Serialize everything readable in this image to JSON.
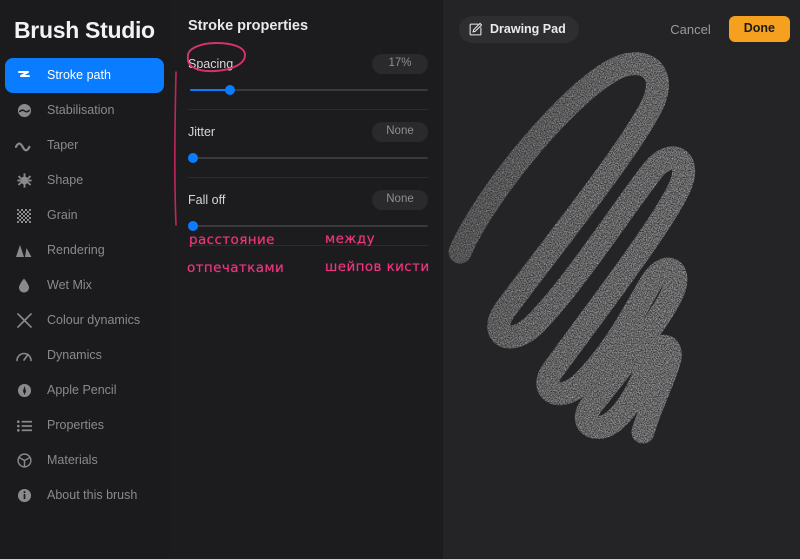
{
  "app": {
    "title": "Brush Studio"
  },
  "sidebar": {
    "items": [
      {
        "label": "Stroke path",
        "icon": "stroke-path-icon",
        "active": true
      },
      {
        "label": "Stabilisation",
        "icon": "stabilisation-icon",
        "active": false
      },
      {
        "label": "Taper",
        "icon": "taper-icon",
        "active": false
      },
      {
        "label": "Shape",
        "icon": "shape-icon",
        "active": false
      },
      {
        "label": "Grain",
        "icon": "grain-icon",
        "active": false
      },
      {
        "label": "Rendering",
        "icon": "rendering-icon",
        "active": false
      },
      {
        "label": "Wet Mix",
        "icon": "wet-mix-icon",
        "active": false
      },
      {
        "label": "Colour dynamics",
        "icon": "colour-dynamics-icon",
        "active": false
      },
      {
        "label": "Dynamics",
        "icon": "dynamics-icon",
        "active": false
      },
      {
        "label": "Apple Pencil",
        "icon": "apple-pencil-icon",
        "active": false
      },
      {
        "label": "Properties",
        "icon": "properties-icon",
        "active": false
      },
      {
        "label": "Materials",
        "icon": "materials-icon",
        "active": false
      },
      {
        "label": "About this brush",
        "icon": "about-brush-icon",
        "active": false
      }
    ]
  },
  "properties": {
    "section_title": "Stroke properties",
    "sliders": [
      {
        "label": "Spacing",
        "value": "17%",
        "percent": 17
      },
      {
        "label": "Jitter",
        "value": "None",
        "percent": 0
      },
      {
        "label": "Fall off",
        "value": "None",
        "percent": 0
      }
    ]
  },
  "annotations": {
    "line1": "расстояние",
    "line2": "между",
    "line3": "отпечатками",
    "line4": "шейпов кисти"
  },
  "canvas": {
    "pad_label": "Drawing Pad",
    "pad_icon": "compose-icon",
    "cancel_label": "Cancel",
    "done_label": "Done"
  },
  "colors": {
    "accent_blue": "#0a7cff",
    "accent_orange": "#f5a01e",
    "ink_pink": "#f0367f",
    "sidebar_bg": "#1b1b1d",
    "panel_bg": "#1c1c1e",
    "canvas_bg": "#242426"
  }
}
